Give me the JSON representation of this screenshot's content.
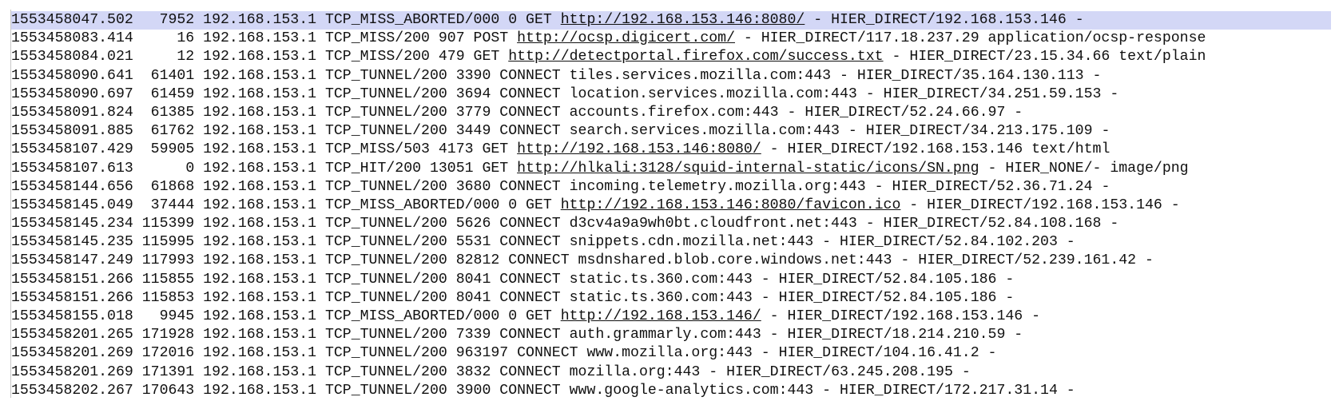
{
  "log": {
    "top_fragment": "  .                     .                    .",
    "lines": [
      {
        "time": "1553458047.502",
        "elapsed": "7952",
        "client": "192.168.153.1",
        "status": "TCP_MISS_ABORTED/000",
        "bytes": "0",
        "method": "GET",
        "url": "http://192.168.153.146:8080/",
        "user": "-",
        "hierarchy": "HIER_DIRECT/192.168.153.146",
        "type": "-",
        "linked": true,
        "selected": true
      },
      {
        "time": "1553458083.414",
        "elapsed": "16",
        "client": "192.168.153.1",
        "status": "TCP_MISS/200",
        "bytes": "907",
        "method": "POST",
        "url": "http://ocsp.digicert.com/",
        "user": "-",
        "hierarchy": "HIER_DIRECT/117.18.237.29",
        "type": "application/ocsp-response",
        "linked": true
      },
      {
        "time": "1553458084.021",
        "elapsed": "12",
        "client": "192.168.153.1",
        "status": "TCP_MISS/200",
        "bytes": "479",
        "method": "GET",
        "url": "http://detectportal.firefox.com/success.txt",
        "user": "-",
        "hierarchy": "HIER_DIRECT/23.15.34.66",
        "type": "text/plain",
        "linked": true
      },
      {
        "time": "1553458090.641",
        "elapsed": "61401",
        "client": "192.168.153.1",
        "status": "TCP_TUNNEL/200",
        "bytes": "3390",
        "method": "CONNECT",
        "url": "tiles.services.mozilla.com:443",
        "user": "-",
        "hierarchy": "HIER_DIRECT/35.164.130.113",
        "type": "-",
        "linked": false
      },
      {
        "time": "1553458090.697",
        "elapsed": "61459",
        "client": "192.168.153.1",
        "status": "TCP_TUNNEL/200",
        "bytes": "3694",
        "method": "CONNECT",
        "url": "location.services.mozilla.com:443",
        "user": "-",
        "hierarchy": "HIER_DIRECT/34.251.59.153",
        "type": "-",
        "linked": false
      },
      {
        "time": "1553458091.824",
        "elapsed": "61385",
        "client": "192.168.153.1",
        "status": "TCP_TUNNEL/200",
        "bytes": "3779",
        "method": "CONNECT",
        "url": "accounts.firefox.com:443",
        "user": "-",
        "hierarchy": "HIER_DIRECT/52.24.66.97",
        "type": "-",
        "linked": false
      },
      {
        "time": "1553458091.885",
        "elapsed": "61762",
        "client": "192.168.153.1",
        "status": "TCP_TUNNEL/200",
        "bytes": "3449",
        "method": "CONNECT",
        "url": "search.services.mozilla.com:443",
        "user": "-",
        "hierarchy": "HIER_DIRECT/34.213.175.109",
        "type": "-",
        "linked": false
      },
      {
        "time": "1553458107.429",
        "elapsed": "59905",
        "client": "192.168.153.1",
        "status": "TCP_MISS/503",
        "bytes": "4173",
        "method": "GET",
        "url": "http://192.168.153.146:8080/",
        "user": "-",
        "hierarchy": "HIER_DIRECT/192.168.153.146",
        "type": "text/html",
        "linked": true
      },
      {
        "time": "1553458107.613",
        "elapsed": "0",
        "client": "192.168.153.1",
        "status": "TCP_HIT/200",
        "bytes": "13051",
        "method": "GET",
        "url": "http://hlkali:3128/squid-internal-static/icons/SN.png",
        "user": "-",
        "hierarchy": "HIER_NONE/-",
        "type": "image/png",
        "linked": true
      },
      {
        "time": "1553458144.656",
        "elapsed": "61868",
        "client": "192.168.153.1",
        "status": "TCP_TUNNEL/200",
        "bytes": "3680",
        "method": "CONNECT",
        "url": "incoming.telemetry.mozilla.org:443",
        "user": "-",
        "hierarchy": "HIER_DIRECT/52.36.71.24",
        "type": "-",
        "linked": false
      },
      {
        "time": "1553458145.049",
        "elapsed": "37444",
        "client": "192.168.153.1",
        "status": "TCP_MISS_ABORTED/000",
        "bytes": "0",
        "method": "GET",
        "url": "http://192.168.153.146:8080/favicon.ico",
        "user": "-",
        "hierarchy": "HIER_DIRECT/192.168.153.146",
        "type": "-",
        "linked": true
      },
      {
        "time": "1553458145.234",
        "elapsed": "115399",
        "client": "192.168.153.1",
        "status": "TCP_TUNNEL/200",
        "bytes": "5626",
        "method": "CONNECT",
        "url": "d3cv4a9a9wh0bt.cloudfront.net:443",
        "user": "-",
        "hierarchy": "HIER_DIRECT/52.84.108.168",
        "type": "-",
        "linked": false
      },
      {
        "time": "1553458145.235",
        "elapsed": "115995",
        "client": "192.168.153.1",
        "status": "TCP_TUNNEL/200",
        "bytes": "5531",
        "method": "CONNECT",
        "url": "snippets.cdn.mozilla.net:443",
        "user": "-",
        "hierarchy": "HIER_DIRECT/52.84.102.203",
        "type": "-",
        "linked": false
      },
      {
        "time": "1553458147.249",
        "elapsed": "117993",
        "client": "192.168.153.1",
        "status": "TCP_TUNNEL/200",
        "bytes": "82812",
        "method": "CONNECT",
        "url": "msdnshared.blob.core.windows.net:443",
        "user": "-",
        "hierarchy": "HIER_DIRECT/52.239.161.42",
        "type": "-",
        "linked": false
      },
      {
        "time": "1553458151.266",
        "elapsed": "115855",
        "client": "192.168.153.1",
        "status": "TCP_TUNNEL/200",
        "bytes": "8041",
        "method": "CONNECT",
        "url": "static.ts.360.com:443",
        "user": "-",
        "hierarchy": "HIER_DIRECT/52.84.105.186",
        "type": "-",
        "linked": false
      },
      {
        "time": "1553458151.266",
        "elapsed": "115853",
        "client": "192.168.153.1",
        "status": "TCP_TUNNEL/200",
        "bytes": "8041",
        "method": "CONNECT",
        "url": "static.ts.360.com:443",
        "user": "-",
        "hierarchy": "HIER_DIRECT/52.84.105.186",
        "type": "-",
        "linked": false
      },
      {
        "time": "1553458155.018",
        "elapsed": "9945",
        "client": "192.168.153.1",
        "status": "TCP_MISS_ABORTED/000",
        "bytes": "0",
        "method": "GET",
        "url": "http://192.168.153.146/",
        "user": "-",
        "hierarchy": "HIER_DIRECT/192.168.153.146",
        "type": "-",
        "linked": true
      },
      {
        "time": "1553458201.265",
        "elapsed": "171928",
        "client": "192.168.153.1",
        "status": "TCP_TUNNEL/200",
        "bytes": "7339",
        "method": "CONNECT",
        "url": "auth.grammarly.com:443",
        "user": "-",
        "hierarchy": "HIER_DIRECT/18.214.210.59",
        "type": "-",
        "linked": false
      },
      {
        "time": "1553458201.269",
        "elapsed": "172016",
        "client": "192.168.153.1",
        "status": "TCP_TUNNEL/200",
        "bytes": "963197",
        "method": "CONNECT",
        "url": "www.mozilla.org:443",
        "user": "-",
        "hierarchy": "HIER_DIRECT/104.16.41.2",
        "type": "-",
        "linked": false
      },
      {
        "time": "1553458201.269",
        "elapsed": "171391",
        "client": "192.168.153.1",
        "status": "TCP_TUNNEL/200",
        "bytes": "3832",
        "method": "CONNECT",
        "url": "mozilla.org:443",
        "user": "-",
        "hierarchy": "HIER_DIRECT/63.245.208.195",
        "type": "-",
        "linked": false
      },
      {
        "time": "1553458202.267",
        "elapsed": "170643",
        "client": "192.168.153.1",
        "status": "TCP_TUNNEL/200",
        "bytes": "3900",
        "method": "CONNECT",
        "url": "www.google-analytics.com:443",
        "user": "-",
        "hierarchy": "HIER_DIRECT/172.217.31.14",
        "type": "-",
        "linked": false
      }
    ]
  }
}
